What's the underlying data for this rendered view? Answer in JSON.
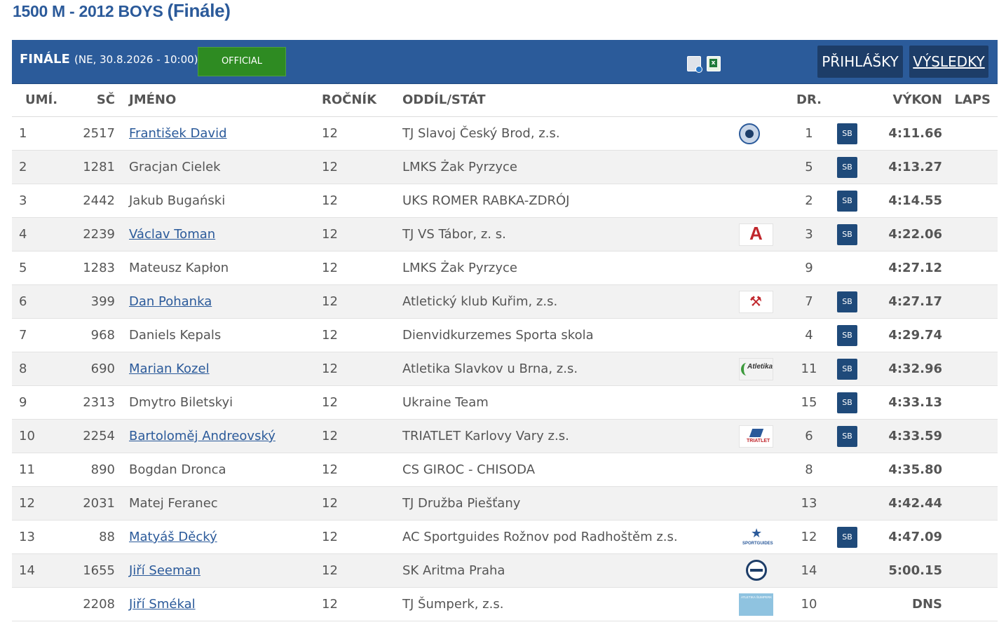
{
  "page": {
    "title_main": "1500 M - 2012 BOYS",
    "title_round": "(Finále)"
  },
  "header": {
    "round_label": "FINÁLE",
    "datetime": "(NE, 30.8.2026 - 10:00)",
    "status_button": "OFFICIAL",
    "entries_button": "PŘIHLÁŠKY",
    "results_button": "VÝSLEDKY",
    "download_icons": [
      "pdf-file-icon",
      "excel-file-icon"
    ]
  },
  "table": {
    "columns": {
      "rank": "UMÍ.",
      "bib": "SČ",
      "name": "JMÉNO",
      "yob": "ROČNÍK",
      "club": "ODDÍL/STÁT",
      "lane": "DR.",
      "perf": "VÝKON",
      "laps": "LAPS"
    },
    "rows": [
      {
        "rank": "1",
        "bib": "2517",
        "name": "František David",
        "link": true,
        "yob": "12",
        "club": "TJ Slavoj Český Brod, z.s.",
        "logo": "round",
        "lane": "1",
        "badge": "SB",
        "perf": "4:11.66"
      },
      {
        "rank": "2",
        "bib": "1281",
        "name": "Gracjan Cielek",
        "link": false,
        "yob": "12",
        "club": "LMKS Żak Pyrzyce",
        "logo": "",
        "lane": "5",
        "badge": "SB",
        "perf": "4:13.27"
      },
      {
        "rank": "3",
        "bib": "2442",
        "name": "Jakub Bugański",
        "link": false,
        "yob": "12",
        "club": "UKS ROMER RABKA-ZDRÓJ",
        "logo": "",
        "lane": "2",
        "badge": "SB",
        "perf": "4:14.55"
      },
      {
        "rank": "4",
        "bib": "2239",
        "name": "Václav Toman",
        "link": true,
        "yob": "12",
        "club": "TJ VS Tábor, z. s.",
        "logo": "a",
        "lane": "3",
        "badge": "SB",
        "perf": "4:22.06"
      },
      {
        "rank": "5",
        "bib": "1283",
        "name": "Mateusz Kapłon",
        "link": false,
        "yob": "12",
        "club": "LMKS Żak Pyrzyce",
        "logo": "",
        "lane": "9",
        "badge": "",
        "perf": "4:27.12"
      },
      {
        "rank": "6",
        "bib": "399",
        "name": "Dan Pohanka",
        "link": true,
        "yob": "12",
        "club": "Atletický klub Kuřim, z.s.",
        "logo": "runner",
        "lane": "7",
        "badge": "SB",
        "perf": "4:27.17"
      },
      {
        "rank": "7",
        "bib": "968",
        "name": "Daniels Kepals",
        "link": false,
        "yob": "12",
        "club": "Dienvidkurzemes Sporta skola",
        "logo": "",
        "lane": "4",
        "badge": "SB",
        "perf": "4:29.74"
      },
      {
        "rank": "8",
        "bib": "690",
        "name": "Marian Kozel",
        "link": true,
        "yob": "12",
        "club": "Atletika Slavkov u Brna, z.s.",
        "logo": "atletika",
        "lane": "11",
        "badge": "SB",
        "perf": "4:32.96"
      },
      {
        "rank": "9",
        "bib": "2313",
        "name": "Dmytro Biletskyi",
        "link": false,
        "yob": "12",
        "club": "Ukraine Team",
        "logo": "",
        "lane": "15",
        "badge": "SB",
        "perf": "4:33.13"
      },
      {
        "rank": "10",
        "bib": "2254",
        "name": "Bartoloměj Andreovský",
        "link": true,
        "yob": "12",
        "club": "TRIATLET Karlovy Vary z.s.",
        "logo": "triatlet",
        "lane": "6",
        "badge": "SB",
        "perf": "4:33.59"
      },
      {
        "rank": "11",
        "bib": "890",
        "name": "Bogdan Dronca",
        "link": false,
        "yob": "12",
        "club": "CS GIROC - CHISODA",
        "logo": "",
        "lane": "8",
        "badge": "",
        "perf": "4:35.80"
      },
      {
        "rank": "12",
        "bib": "2031",
        "name": "Matej Feranec",
        "link": false,
        "yob": "12",
        "club": "TJ Družba Piešťany",
        "logo": "",
        "lane": "13",
        "badge": "",
        "perf": "4:42.44"
      },
      {
        "rank": "13",
        "bib": "88",
        "name": "Matyáš Děcký",
        "link": true,
        "yob": "12",
        "club": "AC Sportguides Rožnov pod Radhoštěm z.s.",
        "logo": "sport",
        "lane": "12",
        "badge": "SB",
        "perf": "4:47.09"
      },
      {
        "rank": "14",
        "bib": "1655",
        "name": "Jiří Seeman",
        "link": true,
        "yob": "12",
        "club": "SK Aritma Praha",
        "logo": "aritma",
        "lane": "14",
        "badge": "",
        "perf": "5:00.15"
      },
      {
        "rank": "",
        "bib": "2208",
        "name": "Jiří Smékal",
        "link": true,
        "yob": "12",
        "club": "TJ Šumperk, z.s.",
        "logo": "sumperk",
        "lane": "10",
        "badge": "",
        "perf": "DNS"
      }
    ]
  }
}
